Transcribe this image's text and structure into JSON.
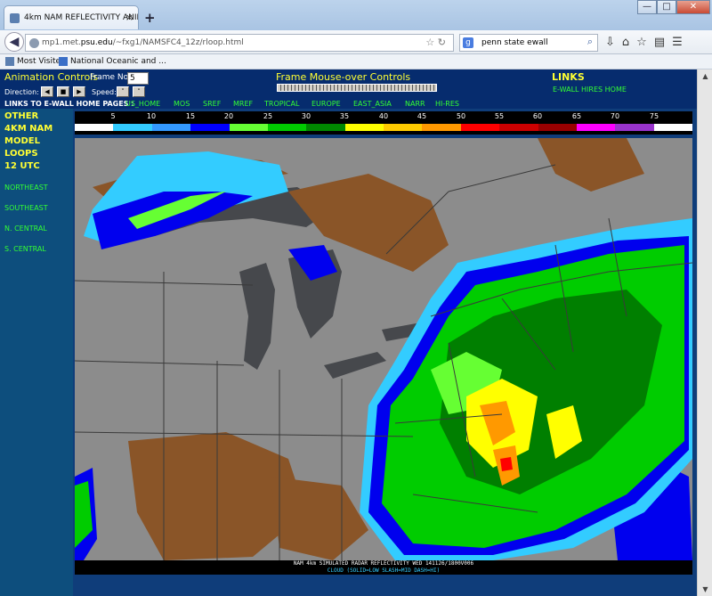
{
  "browser": {
    "tab_title": "4km NAM REFLECTIVITY ANIMATI...",
    "tab_close": "×",
    "new_tab": "+",
    "url_prefix": "mp1.met.",
    "url_host": "psu.edu",
    "url_path": "/~fxg1/NAMSFC4_12z/rloop.html",
    "search_value": "penn state ewall",
    "search_engine_letter": "g",
    "bookmarks": [
      "Most Visited",
      "National Oceanic and ..."
    ],
    "icons": [
      "back-icon",
      "globe-icon",
      "reload-icon",
      "search-icon",
      "download-icon",
      "home-icon",
      "star-icon",
      "reader-icon",
      "menu-icon"
    ]
  },
  "controls": {
    "animation_title": "Animation Controls",
    "frame_label": "Frame No:",
    "frame_value": "5",
    "direction_label": "Direction:",
    "speed_label": "Speed:",
    "mouseover_title": "Frame Mouse-over Controls",
    "links_title": "LINKS",
    "hires_link": "E-WALL HIRES HOME"
  },
  "linkrow": {
    "lead": "LINKS TO E-WALL HOME PAGES :",
    "items": [
      "US_HOME",
      "MOS",
      "SREF",
      "MREF",
      "TROPICAL",
      "EUROPE",
      "EAST_ASIA",
      "NARR",
      "HI-RES"
    ]
  },
  "sidebar": {
    "heading": [
      "OTHER",
      "4KM NAM",
      "MODEL",
      "LOOPS",
      "12 UTC"
    ],
    "links": [
      "NORTHEAST",
      "SOUTHEAST",
      "N. CENTRAL",
      "S. CENTRAL"
    ]
  },
  "legend": {
    "ticks": [
      "5",
      "10",
      "15",
      "20",
      "25",
      "30",
      "35",
      "40",
      "45",
      "50",
      "55",
      "60",
      "65",
      "70",
      "75"
    ],
    "colors": [
      "#ffffff",
      "#33ccff",
      "#3399ff",
      "#0000ff",
      "#66ff33",
      "#00cc00",
      "#008800",
      "#ffff00",
      "#ffcc00",
      "#ff9900",
      "#ff0000",
      "#cc0000",
      "#990000",
      "#ff00ff",
      "#9933cc",
      "#ffffff"
    ]
  },
  "caption": {
    "line1": "NAM 4km SIMULATED RADAR REFLECTIVITY WED 141126/1800V006",
    "line2": "CLOUD (SOLID=LOW SLASH=MID DASH=HI)"
  },
  "map_colors": {
    "land": "#8c8c8c",
    "lake": "#46484c",
    "border": "#3a3a3a",
    "brown": "#8a5528",
    "light_blue": "#33ccff",
    "blue": "#0000ee",
    "green_light": "#66ff33",
    "green": "#00cc00",
    "green_dark": "#007f00",
    "yellow": "#ffff00",
    "orange": "#ff9900",
    "red": "#ff0000"
  }
}
